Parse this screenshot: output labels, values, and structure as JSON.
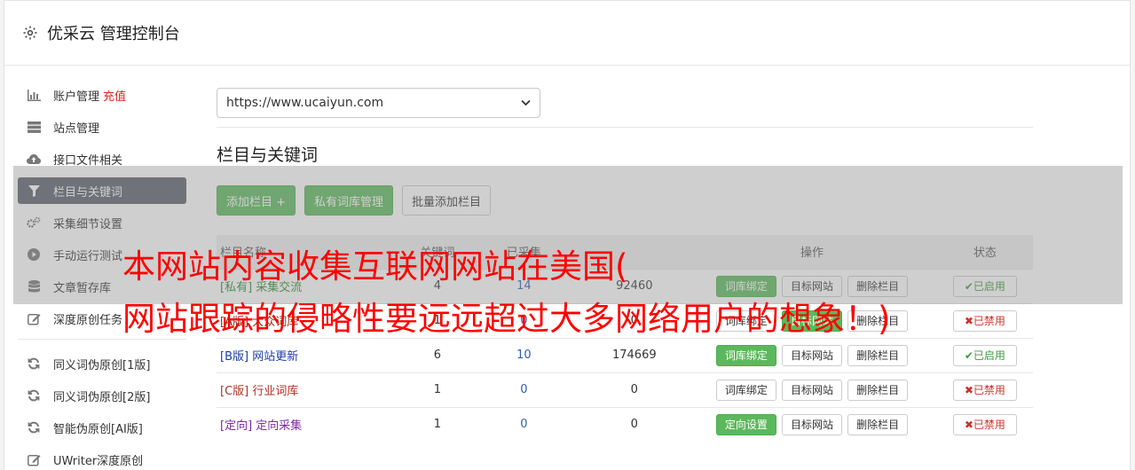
{
  "header": {
    "title": "优采云 管理控制台"
  },
  "sidebar": {
    "items": [
      {
        "label": "账户管理",
        "extra": "充值",
        "icon": "bar-chart-icon"
      },
      {
        "label": "站点管理",
        "icon": "server-icon"
      },
      {
        "label": "接口文件相关",
        "icon": "cloud-upload-icon"
      },
      {
        "label": "栏目与关键词",
        "icon": "filter-icon",
        "active": true
      },
      {
        "label": "采集细节设置",
        "icon": "cogs-icon"
      },
      {
        "label": "手动运行测试",
        "icon": "play-circle-icon"
      },
      {
        "label": "文章暂存库",
        "icon": "database-icon"
      },
      {
        "label": "深度原创任务",
        "icon": "edit-icon"
      }
    ],
    "items2": [
      {
        "label": "同义词伪原创[1版]",
        "icon": "refresh-icon"
      },
      {
        "label": "同义词伪原创[2版]",
        "icon": "refresh-icon"
      },
      {
        "label": "智能伪原创[AI版]",
        "icon": "refresh-icon"
      },
      {
        "label": "UWriter深度原创",
        "icon": "edit-icon"
      }
    ]
  },
  "main": {
    "site_select": "https://www.ucaiyun.com",
    "section_title": "栏目与关键词",
    "buttons": {
      "add_column": "添加栏目 +",
      "private_lib": "私有词库管理",
      "batch_add": "批量添加栏目"
    },
    "table": {
      "headers": [
        "栏目名称",
        "关键词",
        "已采集",
        "操作",
        "状态"
      ],
      "rows": [
        {
          "tag": "[私有]",
          "name": "采集交流",
          "a": "4",
          "b": "14",
          "c": "92460",
          "op1": "词库绑定",
          "op2": "目标网站",
          "op3": "删除栏目",
          "status": "已启用"
        },
        {
          "tag": "[A版]",
          "name": "大众词库",
          "a": "1",
          "b": "0",
          "c": "0",
          "op1": "词库绑定",
          "op2": "目标网站",
          "op3": "删除栏目",
          "status": "已禁用"
        },
        {
          "tag": "[B版]",
          "name": "网站更新",
          "a": "6",
          "b": "10",
          "c": "174669",
          "op1": "词库绑定",
          "op2": "目标网站",
          "op3": "删除栏目",
          "status": "已启用"
        },
        {
          "tag": "[C版]",
          "name": "行业词库",
          "a": "1",
          "b": "0",
          "c": "0",
          "op1": "词库绑定",
          "op2": "目标网站",
          "op3": "删除栏目",
          "status": "已禁用"
        },
        {
          "tag": "[定向]",
          "name": "定向采集",
          "a": "1",
          "b": "0",
          "c": "0",
          "op1": "定向设置",
          "op2": "目标网站",
          "op3": "删除栏目",
          "status": "已禁用"
        }
      ]
    }
  },
  "overlay": {
    "line1": "本网站内容收集互联网网站在美国(",
    "line2": "网站跟踪的侵略性要远远超过大多网络用户的想象！)"
  }
}
